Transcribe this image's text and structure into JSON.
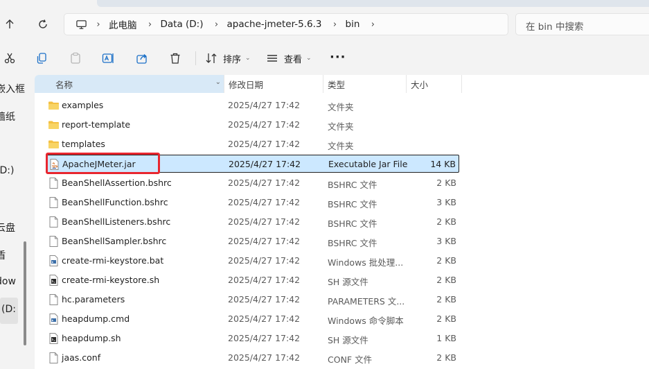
{
  "breadcrumbs": [
    "此电脑",
    "Data (D:)",
    "apache-jmeter-5.6.3",
    "bin"
  ],
  "search": {
    "placeholder": "在 bin 中搜索"
  },
  "toolbar": {
    "sort_label": "排序",
    "view_label": "查看",
    "more_label": "···"
  },
  "left_nav": [
    {
      "label": "嵌入框"
    },
    {
      "label": "墙纸"
    },
    {
      "label": "(D:)"
    },
    {
      "label": "云盘"
    },
    {
      "label": "盾"
    },
    {
      "label": "dow"
    },
    {
      "label": "(D:"
    }
  ],
  "columns": {
    "name": "名称",
    "date": "修改日期",
    "type": "类型",
    "size": "大小"
  },
  "files": [
    {
      "name": "examples",
      "date": "2025/4/27 17:42",
      "type": "文件夹",
      "size": "",
      "icon": "folder-icon"
    },
    {
      "name": "report-template",
      "date": "2025/4/27 17:42",
      "type": "文件夹",
      "size": "",
      "icon": "folder-icon"
    },
    {
      "name": "templates",
      "date": "2025/4/27 17:42",
      "type": "文件夹",
      "size": "",
      "icon": "folder-icon"
    },
    {
      "name": "ApacheJMeter.jar",
      "date": "2025/4/27 17:42",
      "type": "Executable Jar File",
      "size": "14 KB",
      "icon": "jar-file-icon",
      "selected": true
    },
    {
      "name": "BeanShellAssertion.bshrc",
      "date": "2025/4/27 17:42",
      "type": "BSHRC 文件",
      "size": "2 KB",
      "icon": "file-icon"
    },
    {
      "name": "BeanShellFunction.bshrc",
      "date": "2025/4/27 17:42",
      "type": "BSHRC 文件",
      "size": "3 KB",
      "icon": "file-icon"
    },
    {
      "name": "BeanShellListeners.bshrc",
      "date": "2025/4/27 17:42",
      "type": "BSHRC 文件",
      "size": "2 KB",
      "icon": "file-icon"
    },
    {
      "name": "BeanShellSampler.bshrc",
      "date": "2025/4/27 17:42",
      "type": "BSHRC 文件",
      "size": "3 KB",
      "icon": "file-icon"
    },
    {
      "name": "create-rmi-keystore.bat",
      "date": "2025/4/27 17:42",
      "type": "Windows 批处理...",
      "size": "2 KB",
      "icon": "batch-file-icon"
    },
    {
      "name": "create-rmi-keystore.sh",
      "date": "2025/4/27 17:42",
      "type": "SH 源文件",
      "size": "2 KB",
      "icon": "script-file-icon"
    },
    {
      "name": "hc.parameters",
      "date": "2025/4/27 17:42",
      "type": "PARAMETERS 文...",
      "size": "2 KB",
      "icon": "file-icon"
    },
    {
      "name": "heapdump.cmd",
      "date": "2025/4/27 17:42",
      "type": "Windows 命令脚本",
      "size": "2 KB",
      "icon": "batch-file-icon"
    },
    {
      "name": "heapdump.sh",
      "date": "2025/4/27 17:42",
      "type": "SH 源文件",
      "size": "1 KB",
      "icon": "script-file-icon"
    },
    {
      "name": "jaas.conf",
      "date": "2025/4/27 17:42",
      "type": "CONF 文件",
      "size": "2 KB",
      "icon": "file-icon"
    }
  ],
  "colors": {
    "selection": "#cce8ff",
    "highlight": "#e8262f",
    "folder": "#f3c043"
  }
}
